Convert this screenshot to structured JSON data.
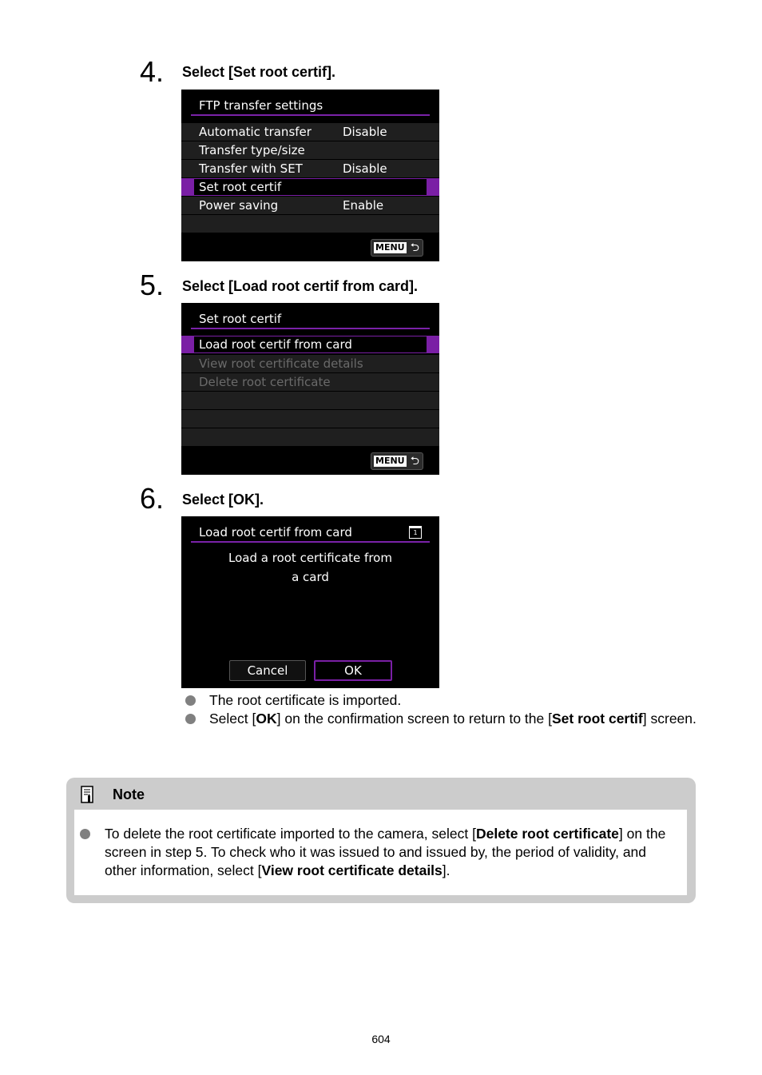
{
  "steps": [
    {
      "number": "4.",
      "title": "Select [Set root certif].",
      "screen": {
        "title": "FTP transfer settings",
        "rows": [
          {
            "label": "Automatic transfer",
            "value": "Disable",
            "state": "normal"
          },
          {
            "label": "Transfer type/size",
            "value": "",
            "state": "normal"
          },
          {
            "label": "Transfer with SET",
            "value": "Disable",
            "state": "normal"
          },
          {
            "label": "Set root certif",
            "value": "",
            "state": "selected"
          },
          {
            "label": "Power saving",
            "value": "Enable",
            "state": "normal"
          },
          {
            "label": "",
            "value": "",
            "state": "empty"
          }
        ],
        "menu_button": {
          "label": "MENU",
          "icon": "return-arrow-icon"
        }
      }
    },
    {
      "number": "5.",
      "title": "Select [Load root certif from card].",
      "screen": {
        "title": "Set root certif",
        "rows": [
          {
            "label": "Load root certif from card",
            "state": "selected"
          },
          {
            "label": "View root certificate details",
            "state": "disabled"
          },
          {
            "label": "Delete root certificate",
            "state": "disabled"
          },
          {
            "label": "",
            "state": "empty"
          },
          {
            "label": "",
            "state": "empty"
          },
          {
            "label": "",
            "state": "empty"
          }
        ],
        "menu_button": {
          "label": "MENU",
          "icon": "return-arrow-icon"
        }
      }
    },
    {
      "number": "6.",
      "title": "Select [OK].",
      "screen": {
        "title": "Load root certif from card",
        "card_icon": "1",
        "message_line1": "Load a root certificate from",
        "message_line2": "a card",
        "cancel_label": "Cancel",
        "ok_label": "OK"
      },
      "bullets": [
        {
          "parts": [
            {
              "text": "The root certificate is imported.",
              "bold": false
            }
          ]
        },
        {
          "parts": [
            {
              "text": "Select [",
              "bold": false
            },
            {
              "text": "OK",
              "bold": true
            },
            {
              "text": "] on the confirmation screen to return to the [",
              "bold": false
            },
            {
              "text": "Set root certif",
              "bold": true
            },
            {
              "text": "] screen.",
              "bold": false
            }
          ]
        }
      ]
    }
  ],
  "note": {
    "heading": "Note",
    "icon": "memo-pencil-icon",
    "parts": [
      {
        "text": "To delete the root certificate imported to the camera, select [",
        "bold": false
      },
      {
        "text": "Delete root certificate",
        "bold": true
      },
      {
        "text": "] on the screen in step 5. To check who it was issued to and issued by, the period of validity, and other information, select [",
        "bold": false
      },
      {
        "text": "View root certificate details",
        "bold": true
      },
      {
        "text": "].",
        "bold": false
      }
    ]
  },
  "page_number": "604",
  "colors": {
    "accent_purple": "#7a1fa5",
    "row_bg": "#1f1f1f",
    "disabled_text": "#6a6a6a",
    "note_frame": "#cccccc",
    "bullet_gray": "#808080"
  }
}
